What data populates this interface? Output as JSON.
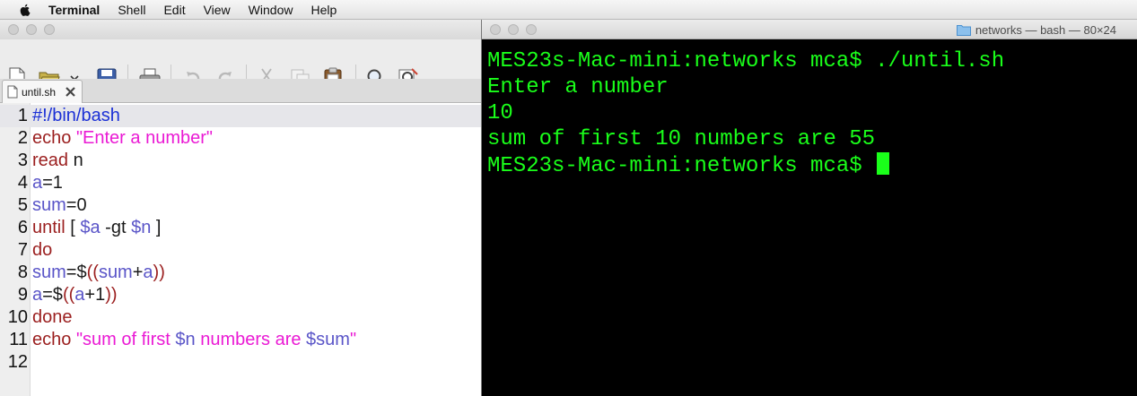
{
  "menubar": {
    "app_name": "Terminal",
    "items": [
      "Shell",
      "Edit",
      "View",
      "Window",
      "Help"
    ]
  },
  "editor": {
    "tab_label": "until.sh",
    "toolbar_icons": [
      "new-document-icon",
      "open-folder-icon",
      "dropdown-icon",
      "save-icon",
      "print-icon",
      "undo-icon",
      "redo-icon",
      "cut-icon",
      "copy-icon",
      "paste-icon",
      "find-icon",
      "find-replace-icon"
    ],
    "current_line": 1,
    "lines": [
      {
        "n": "1",
        "tokens": [
          {
            "t": "#!/bin/bash",
            "c": "shebang"
          }
        ]
      },
      {
        "n": "2",
        "tokens": [
          {
            "t": "echo",
            "c": "kw"
          },
          {
            "t": " ",
            "c": "plain"
          },
          {
            "t": "\"Enter a number\"",
            "c": "str"
          }
        ]
      },
      {
        "n": "3",
        "tokens": [
          {
            "t": "read",
            "c": "kw"
          },
          {
            "t": " n",
            "c": "plain"
          }
        ]
      },
      {
        "n": "4",
        "tokens": [
          {
            "t": "a",
            "c": "var"
          },
          {
            "t": "=1",
            "c": "plain"
          }
        ]
      },
      {
        "n": "5",
        "tokens": [
          {
            "t": "sum",
            "c": "var"
          },
          {
            "t": "=0",
            "c": "plain"
          }
        ]
      },
      {
        "n": "6",
        "tokens": [
          {
            "t": "until",
            "c": "kw"
          },
          {
            "t": " [ ",
            "c": "plain"
          },
          {
            "t": "$a",
            "c": "var"
          },
          {
            "t": " -gt ",
            "c": "plain"
          },
          {
            "t": "$n",
            "c": "var"
          },
          {
            "t": " ]",
            "c": "plain"
          }
        ]
      },
      {
        "n": "7",
        "tokens": [
          {
            "t": "do",
            "c": "kw"
          }
        ]
      },
      {
        "n": "8",
        "tokens": [
          {
            "t": "sum",
            "c": "var"
          },
          {
            "t": "=$",
            "c": "plain"
          },
          {
            "t": "((",
            "c": "kw"
          },
          {
            "t": "sum",
            "c": "var"
          },
          {
            "t": "+",
            "c": "plain"
          },
          {
            "t": "a",
            "c": "var"
          },
          {
            "t": "))",
            "c": "kw"
          }
        ]
      },
      {
        "n": "9",
        "tokens": [
          {
            "t": "a",
            "c": "var"
          },
          {
            "t": "=$",
            "c": "plain"
          },
          {
            "t": "((",
            "c": "kw"
          },
          {
            "t": "a",
            "c": "var"
          },
          {
            "t": "+1",
            "c": "plain"
          },
          {
            "t": "))",
            "c": "kw"
          }
        ]
      },
      {
        "n": "10",
        "tokens": [
          {
            "t": "done",
            "c": "kw"
          }
        ]
      },
      {
        "n": "11",
        "tokens": [
          {
            "t": "echo",
            "c": "kw"
          },
          {
            "t": " ",
            "c": "plain"
          },
          {
            "t": "\"sum of first ",
            "c": "str"
          },
          {
            "t": "$n",
            "c": "var"
          },
          {
            "t": " numbers are ",
            "c": "str"
          },
          {
            "t": "$sum",
            "c": "var"
          },
          {
            "t": "\"",
            "c": "str"
          }
        ]
      },
      {
        "n": "12",
        "tokens": []
      }
    ]
  },
  "terminal": {
    "title": "networks — bash — 80×24",
    "title_icon": "folder-icon",
    "lines": [
      "MES23s-Mac-mini:networks mca$ ./until.sh",
      "Enter a number",
      "10",
      "sum of first 10 numbers are 55",
      "MES23s-Mac-mini:networks mca$ "
    ],
    "colors": {
      "background": "#000000",
      "text": "#1aff1a"
    }
  }
}
